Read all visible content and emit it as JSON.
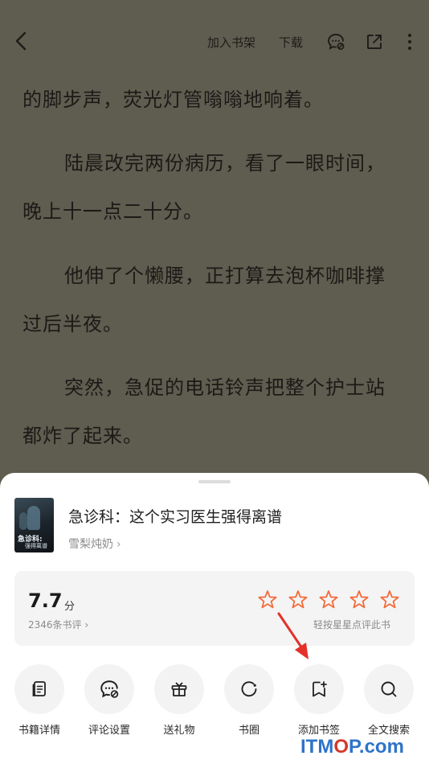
{
  "topbar": {
    "add_to_shelf": "加入书架",
    "download": "下载",
    "icons": [
      "back-icon",
      "comment-settings-icon",
      "share-icon",
      "more-icon"
    ]
  },
  "reader": {
    "paragraphs": [
      "的脚步声，荧光灯管嗡嗡地响着。",
      "陆晨改完两份病历，看了一眼时间，",
      "晚上十一点二十分。",
      "他伸了个懒腰，正打算去泡杯咖啡撑",
      "过后半夜。",
      "突然，急促的电话铃声把整个护士站",
      "都炸了起来。"
    ]
  },
  "book": {
    "title": "急诊科：这个实习医生强得离谱",
    "author": "雪梨炖奶",
    "author_chevron": "›",
    "cover_title": "急诊科:",
    "cover_subtitle": "强得离谱"
  },
  "rating": {
    "score": "7.7",
    "unit": "分",
    "reviews": "2346条书评 ›",
    "hint": "轻按星星点评此书",
    "stars_total": 5,
    "stars_filled": 0,
    "star_color": "#f26b3a"
  },
  "actions": [
    {
      "label": "书籍详情",
      "icon": "book-details-icon"
    },
    {
      "label": "评论设置",
      "icon": "comment-settings-icon"
    },
    {
      "label": "送礼物",
      "icon": "gift-icon"
    },
    {
      "label": "书圈",
      "icon": "circle-icon"
    },
    {
      "label": "添加书签",
      "icon": "bookmark-add-icon"
    },
    {
      "label": "全文搜索",
      "icon": "search-icon"
    }
  ],
  "watermark": {
    "prefix": "IT",
    "middle": "M",
    "dot": "O",
    "suffix": "P.com"
  },
  "colors": {
    "reader_bg": "#5f5c50",
    "annotation_arrow": "#e3312a",
    "watermark_blue": "#2e73c9"
  }
}
